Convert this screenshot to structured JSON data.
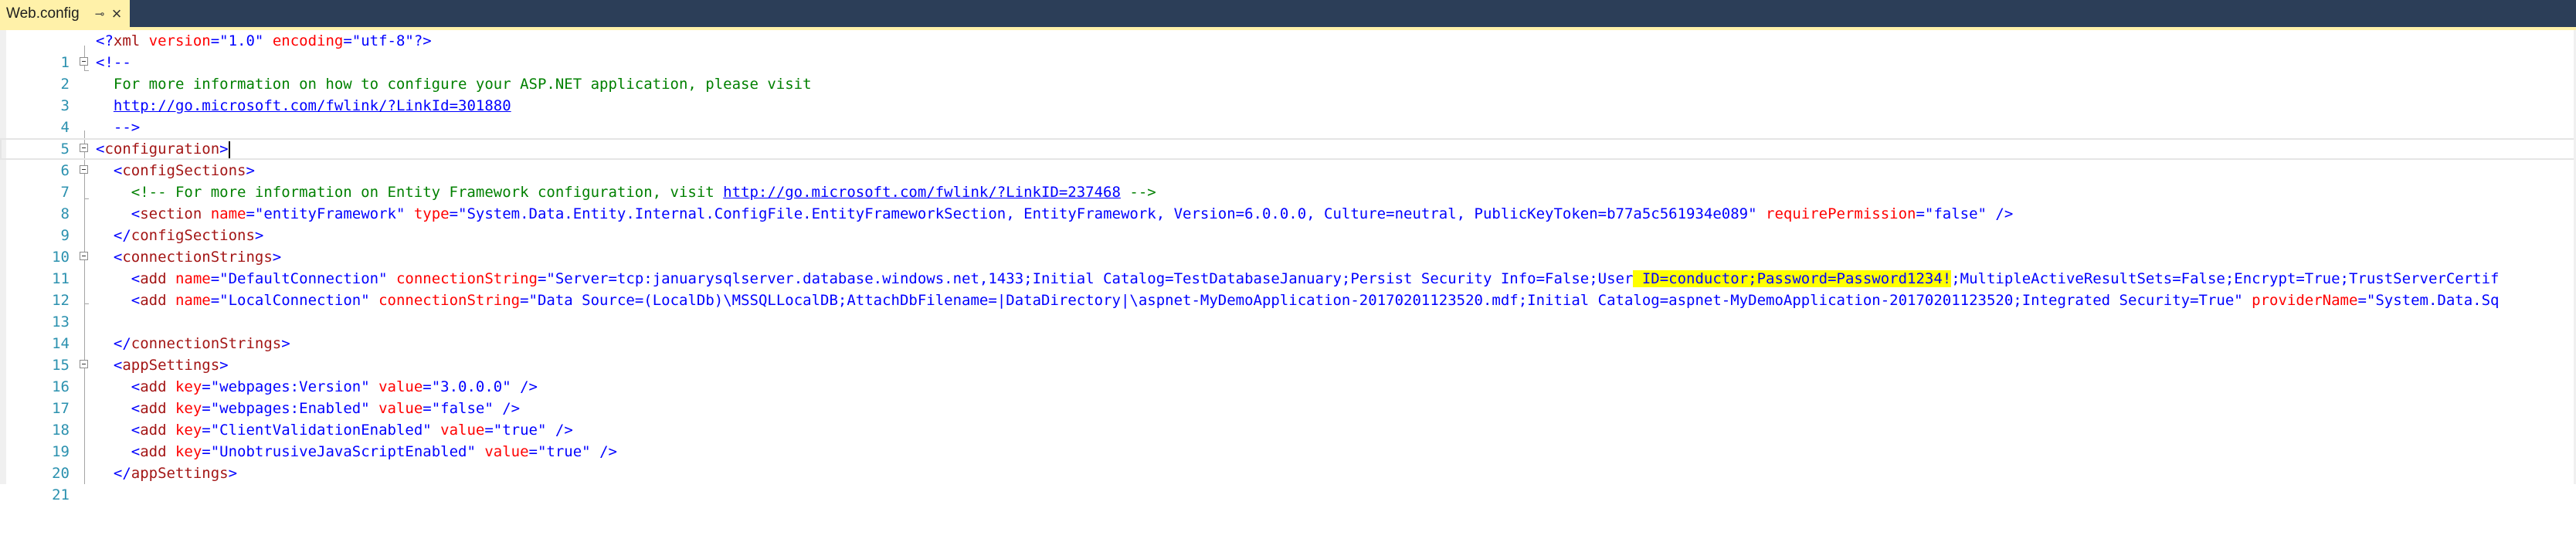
{
  "tab": {
    "title": "Web.config",
    "pin_glyph": "⊸",
    "close_glyph": "×"
  },
  "line_numbers": [
    "1",
    "2",
    "3",
    "4",
    "5",
    "6",
    "7",
    "8",
    "9",
    "10",
    "11",
    "12",
    "13",
    "14",
    "15",
    "16",
    "17",
    "18",
    "19",
    "20",
    "21"
  ],
  "code": {
    "l1": {
      "a": "<?",
      "b": "xml",
      "c": " version",
      "d": "=\"1.0\"",
      "e": " encoding",
      "f": "=\"utf-8\"",
      "g": "?>"
    },
    "l2": {
      "a": "<!--"
    },
    "l3": {
      "a": "  For more information on how to configure your ASP.NET application, please visit"
    },
    "l4": {
      "a": "  ",
      "link": "http://go.microsoft.com/fwlink/?LinkId=301880"
    },
    "l5": {
      "a": "  -->"
    },
    "l6": {
      "a": "<",
      "b": "configuration",
      "c": ">"
    },
    "l7": {
      "a": "  <",
      "b": "configSections",
      "c": ">"
    },
    "l8": {
      "a": "    <!-- For more information on Entity Framework configuration, visit ",
      "link": "http://go.microsoft.com/fwlink/?LinkID=237468",
      "b": " -->"
    },
    "l9": {
      "a": "    <",
      "b": "section",
      "c": " name",
      "d": "=\"entityFramework\"",
      "e": " type",
      "f": "=\"System.Data.Entity.Internal.ConfigFile.EntityFrameworkSection, EntityFramework, Version=6.0.0.0, Culture=neutral, PublicKeyToken=b77a5c561934e089\"",
      "g": " requirePermission",
      "h": "=\"false\"",
      "i": " />"
    },
    "l10": {
      "a": "  </",
      "b": "configSections",
      "c": ">"
    },
    "l11": {
      "a": "  <",
      "b": "connectionStrings",
      "c": ">"
    },
    "l12": {
      "a": "    <",
      "b": "add",
      "c": " name",
      "d": "=\"DefaultConnection\"",
      "e": " connectionString",
      "f": "=\"Server=tcp:januarysqlserver.database.windows.net,1433;Initial Catalog=TestDatabaseJanuary;Persist Security Info=False;User",
      "hl": " ID=conductor;Password=Password1234!",
      "g": ";MultipleActiveResultSets=False;Encrypt=True;TrustServerCertif"
    },
    "l13": {
      "a": "    <",
      "b": "add",
      "c": " name",
      "d": "=\"LocalConnection\"",
      "e": " connectionString",
      "f": "=\"Data Source=(LocalDb)\\MSSQLLocalDB;AttachDbFilename=|DataDirectory|\\aspnet-MyDemoApplication-20170201123520.mdf;Initial Catalog=aspnet-MyDemoApplication-20170201123520;Integrated Security=True\"",
      "g": " providerName",
      "h": "=\"System.Data.Sq"
    },
    "l15": {
      "a": "  </",
      "b": "connectionStrings",
      "c": ">"
    },
    "l16": {
      "a": "  <",
      "b": "appSettings",
      "c": ">"
    },
    "l17": {
      "a": "    <",
      "b": "add",
      "c": " key",
      "d": "=\"webpages:Version\"",
      "e": " value",
      "f": "=\"3.0.0.0\"",
      "g": " />"
    },
    "l18": {
      "a": "    <",
      "b": "add",
      "c": " key",
      "d": "=\"webpages:Enabled\"",
      "e": " value",
      "f": "=\"false\"",
      "g": " />"
    },
    "l19": {
      "a": "    <",
      "b": "add",
      "c": " key",
      "d": "=\"ClientValidationEnabled\"",
      "e": " value",
      "f": "=\"true\"",
      "g": " />"
    },
    "l20": {
      "a": "    <",
      "b": "add",
      "c": " key",
      "d": "=\"UnobtrusiveJavaScriptEnabled\"",
      "e": " value",
      "f": "=\"true\"",
      "g": " />"
    },
    "l21": {
      "a": "  </",
      "b": "appSettings",
      "c": ">"
    }
  },
  "colors": {
    "tab_active": "#fff1a9",
    "tab_strip": "#2c3e58",
    "line_number": "#2b91af",
    "xml_element": "#a31515",
    "xml_attribute": "#ff0000",
    "xml_value": "#0000ff",
    "comment": "#008000",
    "highlight": "#ffff00"
  }
}
